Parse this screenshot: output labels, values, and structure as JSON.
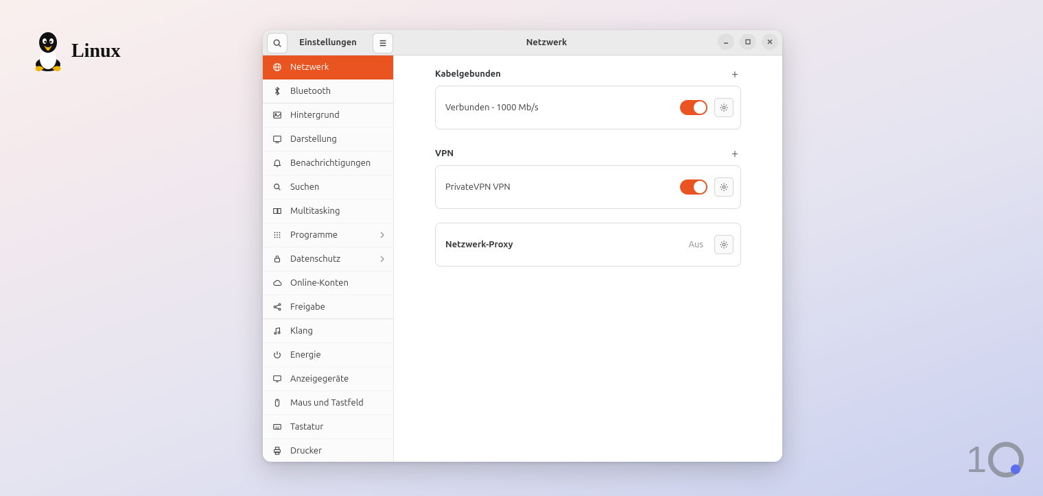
{
  "brand": {
    "name": "Linux"
  },
  "window": {
    "titlebar": {
      "left_title": "Einstellungen",
      "right_title": "Netzwerk"
    }
  },
  "sidebar": {
    "items": [
      {
        "icon": "globe",
        "label": "Netzwerk",
        "active": true,
        "chevron": false,
        "groupEnd": false
      },
      {
        "icon": "bluetooth",
        "label": "Bluetooth",
        "active": false,
        "chevron": false,
        "groupEnd": true
      },
      {
        "icon": "picture",
        "label": "Hintergrund",
        "active": false,
        "chevron": false,
        "groupEnd": false
      },
      {
        "icon": "appearance",
        "label": "Darstellung",
        "active": false,
        "chevron": false,
        "groupEnd": false
      },
      {
        "icon": "bell",
        "label": "Benachrichtigungen",
        "active": false,
        "chevron": false,
        "groupEnd": false
      },
      {
        "icon": "search",
        "label": "Suchen",
        "active": false,
        "chevron": false,
        "groupEnd": false
      },
      {
        "icon": "multitask",
        "label": "Multitasking",
        "active": false,
        "chevron": false,
        "groupEnd": false
      },
      {
        "icon": "apps",
        "label": "Programme",
        "active": false,
        "chevron": true,
        "groupEnd": false
      },
      {
        "icon": "lock",
        "label": "Datenschutz",
        "active": false,
        "chevron": true,
        "groupEnd": false
      },
      {
        "icon": "cloud",
        "label": "Online-Konten",
        "active": false,
        "chevron": false,
        "groupEnd": false
      },
      {
        "icon": "share",
        "label": "Freigabe",
        "active": false,
        "chevron": false,
        "groupEnd": true
      },
      {
        "icon": "music",
        "label": "Klang",
        "active": false,
        "chevron": false,
        "groupEnd": false
      },
      {
        "icon": "power",
        "label": "Energie",
        "active": false,
        "chevron": false,
        "groupEnd": false
      },
      {
        "icon": "display",
        "label": "Anzeigegeräte",
        "active": false,
        "chevron": false,
        "groupEnd": false
      },
      {
        "icon": "mouse",
        "label": "Maus und Tastfeld",
        "active": false,
        "chevron": false,
        "groupEnd": false
      },
      {
        "icon": "keyboard",
        "label": "Tastatur",
        "active": false,
        "chevron": false,
        "groupEnd": false
      },
      {
        "icon": "printer",
        "label": "Drucker",
        "active": false,
        "chevron": false,
        "groupEnd": false
      }
    ]
  },
  "network": {
    "wired": {
      "title": "Kabelgebunden",
      "status": "Verbunden - 1000 Mb/s",
      "enabled": true
    },
    "vpn": {
      "title": "VPN",
      "name": "PrivateVPN VPN",
      "enabled": true
    },
    "proxy": {
      "title": "Netzwerk-Proxy",
      "status": "Aus"
    }
  },
  "colors": {
    "accent": "#e95420"
  }
}
